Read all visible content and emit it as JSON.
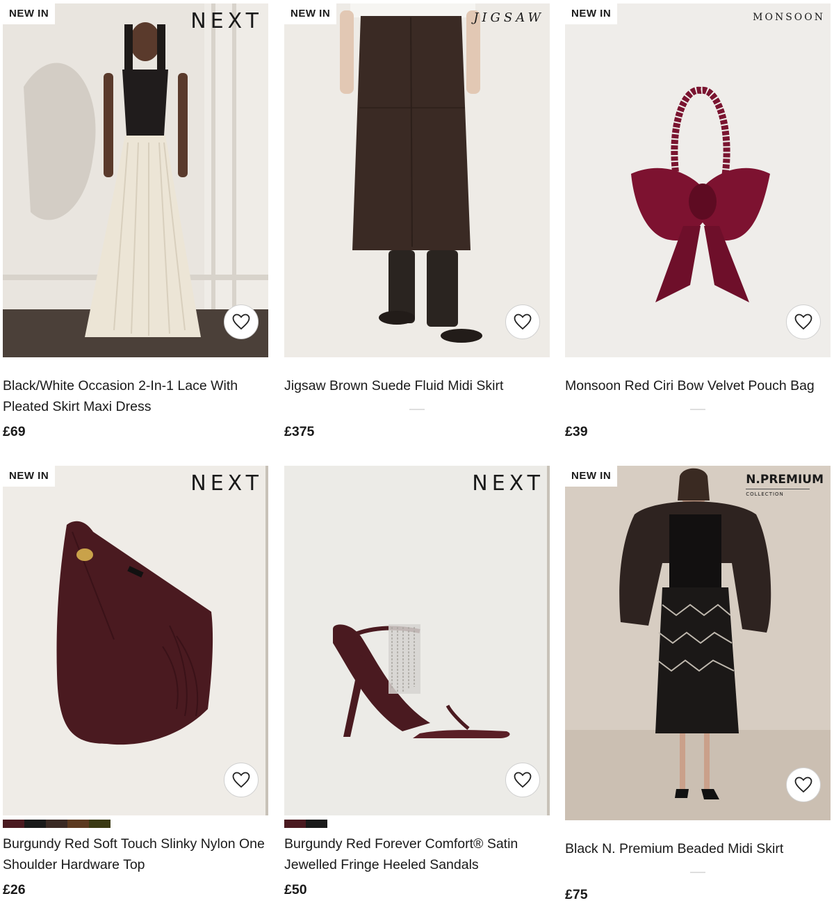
{
  "products": [
    {
      "badge": "NEW IN",
      "brand": "NEXT",
      "title": "Black/White Occasion 2-In-1 Lace With Pleated Skirt Maxi Dress",
      "price": "£69"
    },
    {
      "badge": "NEW IN",
      "brand": "JIGSAW",
      "title": "Jigsaw Brown Suede Fluid Midi Skirt",
      "price": "£375"
    },
    {
      "badge": "NEW IN",
      "brand": "MONSOON",
      "title": "Monsoon Red Ciri Bow Velvet Pouch Bag",
      "price": "£39"
    },
    {
      "badge": "NEW IN",
      "brand": "NEXT",
      "title": "Burgundy Red Soft Touch Slinky Nylon One Shoulder Hardware Top",
      "price": "£26",
      "swatches": [
        "#4a1a20",
        "#1a1a1a",
        "#3a2a24",
        "#5c3a20",
        "#3b3a14"
      ]
    },
    {
      "brand": "NEXT",
      "title": "Burgundy Red Forever Comfort® Satin Jewelled Fringe Heeled Sandals",
      "price": "£50",
      "swatches": [
        "#4a1a20",
        "#1a1a1a"
      ]
    },
    {
      "badge": "NEW IN",
      "brand_main": "N.PREMIUM",
      "brand_sub": "COLLECTION",
      "title": "Black N. Premium Beaded Midi Skirt",
      "price": "£75"
    }
  ],
  "icons": {
    "favourite": "heart-outline-icon"
  }
}
